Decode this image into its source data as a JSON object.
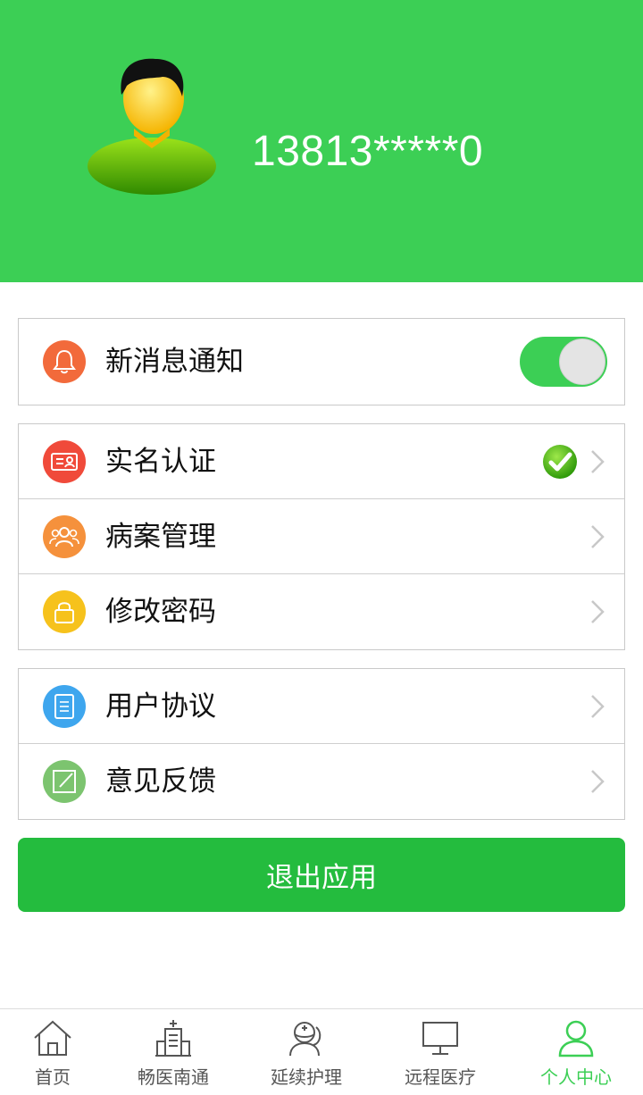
{
  "profile": {
    "phone": "13813*****0"
  },
  "settings": {
    "notification": {
      "label": "新消息通知",
      "enabled": true,
      "icon": "bell-icon",
      "icon_color": "#f26a3b"
    }
  },
  "account_menu": [
    {
      "label": "实名认证",
      "icon": "id-card-icon",
      "icon_color": "#f04a3a",
      "verified": true
    },
    {
      "label": "病案管理",
      "icon": "people-icon",
      "icon_color": "#f5913c"
    },
    {
      "label": "修改密码",
      "icon": "lock-icon",
      "icon_color": "#f6c21c"
    }
  ],
  "info_menu": [
    {
      "label": "用户协议",
      "icon": "document-icon",
      "icon_color": "#3ea6ee"
    },
    {
      "label": "意见反馈",
      "icon": "edit-icon",
      "icon_color": "#7cc46f"
    }
  ],
  "logout_label": "退出应用",
  "tabbar": {
    "active_color": "#3ccf55",
    "items": [
      {
        "label": "首页",
        "icon": "home-icon"
      },
      {
        "label": "畅医南通",
        "icon": "hospital-icon"
      },
      {
        "label": "延续护理",
        "icon": "nurse-icon"
      },
      {
        "label": "远程医疗",
        "icon": "monitor-icon"
      },
      {
        "label": "个人中心",
        "icon": "user-icon",
        "active": true
      }
    ]
  },
  "colors": {
    "header": "#3ccf55",
    "logout_button": "#24bc3e"
  }
}
